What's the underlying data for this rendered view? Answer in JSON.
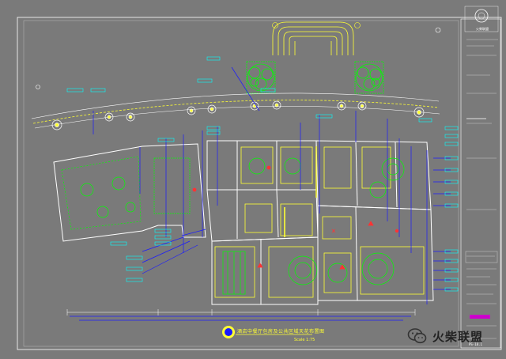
{
  "drawing": {
    "title": "酒店中餐厅包房及公共区域天花布置图",
    "scale": "Scale 1:75",
    "logo_text": "火柴联盟",
    "sheet_no": "PS-18.1"
  },
  "watermark": {
    "text": "火柴联盟",
    "icon": "wechat-icon"
  },
  "colors": {
    "background": "#7a7a7a",
    "wall": "#ffffff",
    "leader": "#1a1aff",
    "lighting": "#ffff33",
    "greenery": "#00ff00",
    "tag": "#00ffff",
    "fixture": "#ff3333",
    "panel": "#cc00cc"
  }
}
